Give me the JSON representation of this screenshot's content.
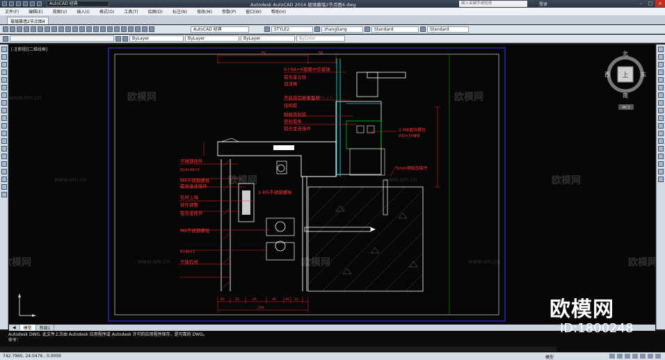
{
  "titlebar": {
    "workspace": "AutoCAD 经典",
    "title": "Autodesk AutoCAD 2014    玻璃幕墙2节点图4.dwg",
    "search_placeholder": "键入关键字或短语",
    "login": "登录"
  },
  "menu": [
    "文件(F)",
    "编辑(E)",
    "视图(V)",
    "插入(I)",
    "格式(O)",
    "工具(T)",
    "绘图(D)",
    "标注(N)",
    "修改(M)",
    "参数(P)",
    "窗口(W)",
    "帮助(H)"
  ],
  "file_tab": "玻璃幕墙2节点图4",
  "toolbar1": {
    "workspace": "AutoCAD 经典",
    "text_style": "STYLE2",
    "dim_style": "zhangliang",
    "table_style": "Standard",
    "mleader_style": "Standard"
  },
  "toolbar2": {
    "color": "ByLayer",
    "linetype": "ByLayer",
    "lineweight": "ByLayer",
    "plotstyle": "ByColor"
  },
  "viewport": {
    "label": "[-][俯视][二维线框]",
    "compass": {
      "north": "北",
      "south": "南",
      "east": "东",
      "west": "西",
      "top": "上",
      "wcs": "WCS"
    }
  },
  "drawing": {
    "annotations_left": [
      "不锈钢挂件",
      "Ø14×56×5",
      "M6不锈钢螺栓",
      "铝合金连接件",
      "石材上端",
      "挂件调整",
      "铝合金挂件",
      "2-M5不锈钢螺栓",
      "干挂石材",
      "6×40×3",
      "M6不锈钢螺栓"
    ],
    "annotations_top": [
      "6+9A+6镀膜中空玻璃",
      "铝合金立柱",
      "泡沫棒",
      "开启扇铝合金型材",
      "结构胶",
      "耐候密封胶",
      "密封胶条",
      "铝合金连接件"
    ],
    "annotations_right": [
      "2-M8镀锌螺栓",
      "5mm钢板连接件",
      "Ø10×56镀锌"
    ],
    "dims_top": [
      "75",
      "50"
    ],
    "dims_bottom": [
      "65",
      "35",
      "45",
      "30",
      "10",
      "15",
      "150"
    ]
  },
  "layout_tabs": [
    "模型",
    "布局1"
  ],
  "command": {
    "line1": "Autodesk DWG.  此文件上次由 Autodesk 应用程序或 Autodesk 许可的应用程序保存，是可靠的 DWG。",
    "line2": "命令："
  },
  "status": {
    "coords": "742.7960, 24.0476 , 0.0000",
    "model": "模型"
  },
  "watermark": {
    "brand": "欧模网",
    "url": "www.om.cn",
    "id": "ID:1800248"
  }
}
